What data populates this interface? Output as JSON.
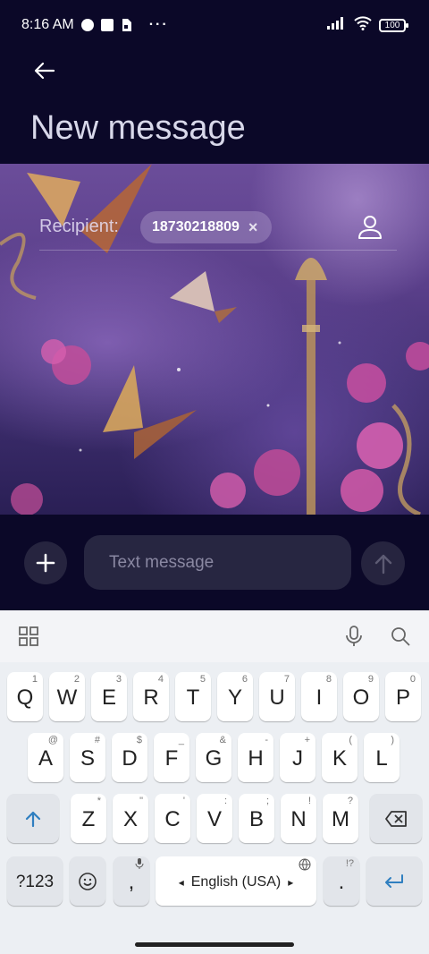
{
  "status_bar": {
    "time": "8:16 AM",
    "more": "···",
    "battery": "100",
    "icons": [
      "notification-icon",
      "square-icon",
      "sim-icon",
      "signal-icon",
      "wifi-icon",
      "battery-icon"
    ]
  },
  "header": {
    "title": "New message",
    "back_icon": "arrow-left-icon"
  },
  "recipient": {
    "label": "Recipient:",
    "chip": "18730218809",
    "remove": "×",
    "contact_icon": "person-icon"
  },
  "composer": {
    "placeholder": "Text message",
    "add_icon": "plus-icon",
    "send_icon": "arrow-up-icon"
  },
  "keyboard": {
    "toolbar_icons": [
      "grid-icon",
      "microphone-icon",
      "search-icon"
    ],
    "row1": [
      {
        "k": "Q",
        "h": "1"
      },
      {
        "k": "W",
        "h": "2"
      },
      {
        "k": "E",
        "h": "3"
      },
      {
        "k": "R",
        "h": "4"
      },
      {
        "k": "T",
        "h": "5"
      },
      {
        "k": "Y",
        "h": "6"
      },
      {
        "k": "U",
        "h": "7"
      },
      {
        "k": "I",
        "h": "8"
      },
      {
        "k": "O",
        "h": "9"
      },
      {
        "k": "P",
        "h": "0"
      }
    ],
    "row2": [
      {
        "k": "A",
        "h": "@"
      },
      {
        "k": "S",
        "h": "#"
      },
      {
        "k": "D",
        "h": "$"
      },
      {
        "k": "F",
        "h": "_"
      },
      {
        "k": "G",
        "h": "&"
      },
      {
        "k": "H",
        "h": "-"
      },
      {
        "k": "J",
        "h": "+"
      },
      {
        "k": "K",
        "h": "("
      },
      {
        "k": "L",
        "h": ")"
      }
    ],
    "row3": [
      {
        "k": "Z",
        "h": "*"
      },
      {
        "k": "X",
        "h": "\""
      },
      {
        "k": "C",
        "h": "'"
      },
      {
        "k": "V",
        "h": ":"
      },
      {
        "k": "B",
        "h": ";"
      },
      {
        "k": "N",
        "h": "!"
      },
      {
        "k": "M",
        "h": "?"
      }
    ],
    "symbols_label": "?123",
    "comma_label": ",",
    "space_label": "English (USA)",
    "period_label": ".",
    "period_hint": "!?",
    "lang_left": "◂",
    "lang_right": "▸"
  }
}
